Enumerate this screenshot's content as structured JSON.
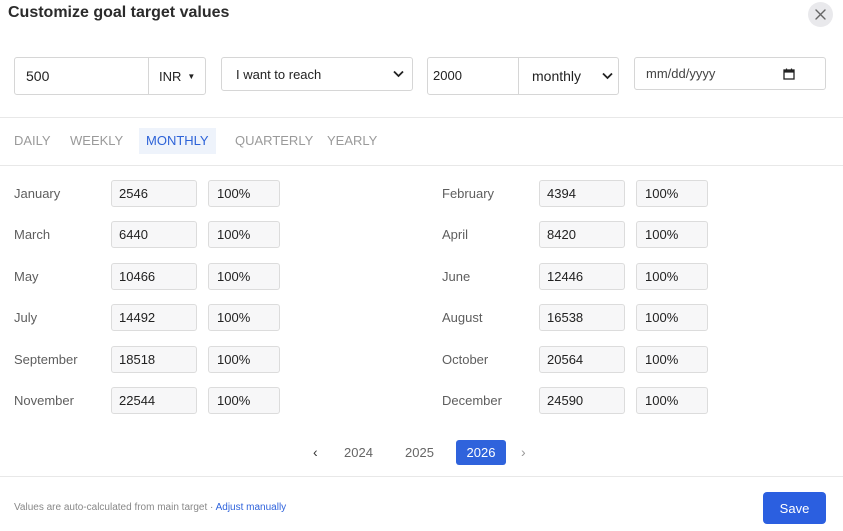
{
  "dialog": {
    "title": "Customize goal target values",
    "close_icon": "close-icon"
  },
  "controls": {
    "amount": "500",
    "currency": "INR",
    "goal_type": "I want to reach",
    "target_value": "2000",
    "period": "monthly",
    "date_placeholder": "mm/dd/yyyy"
  },
  "tabs": [
    {
      "label": "DAILY",
      "active": false
    },
    {
      "label": "WEEKLY",
      "active": false
    },
    {
      "label": "MONTHLY",
      "active": true
    },
    {
      "label": "QUARTERLY",
      "active": false
    },
    {
      "label": "YEARLY",
      "active": false
    }
  ],
  "months": [
    {
      "name": "January",
      "value": "2546",
      "percent": "100%"
    },
    {
      "name": "February",
      "value": "4394",
      "percent": "100%"
    },
    {
      "name": "March",
      "value": "6440",
      "percent": "100%"
    },
    {
      "name": "April",
      "value": "8420",
      "percent": "100%"
    },
    {
      "name": "May",
      "value": "10466",
      "percent": "100%"
    },
    {
      "name": "June",
      "value": "12446",
      "percent": "100%"
    },
    {
      "name": "July",
      "value": "14492",
      "percent": "100%"
    },
    {
      "name": "August",
      "value": "16538",
      "percent": "100%"
    },
    {
      "name": "September",
      "value": "18518",
      "percent": "100%"
    },
    {
      "name": "October",
      "value": "20564",
      "percent": "100%"
    },
    {
      "name": "November",
      "value": "22544",
      "percent": "100%"
    },
    {
      "name": "December",
      "value": "24590",
      "percent": "100%"
    }
  ],
  "pagination": {
    "prev": "‹",
    "years": [
      "2024",
      "2025",
      "2026"
    ],
    "active_year": "2026",
    "next": "›"
  },
  "footer": {
    "note": "Values are auto-calculated from main target · ",
    "link": "Adjust manually",
    "save_label": "Save"
  },
  "colors": {
    "accent": "#2b5fe0",
    "active_tab_bg": "#eef3fb",
    "active_tab_text": "#2d63d8"
  }
}
